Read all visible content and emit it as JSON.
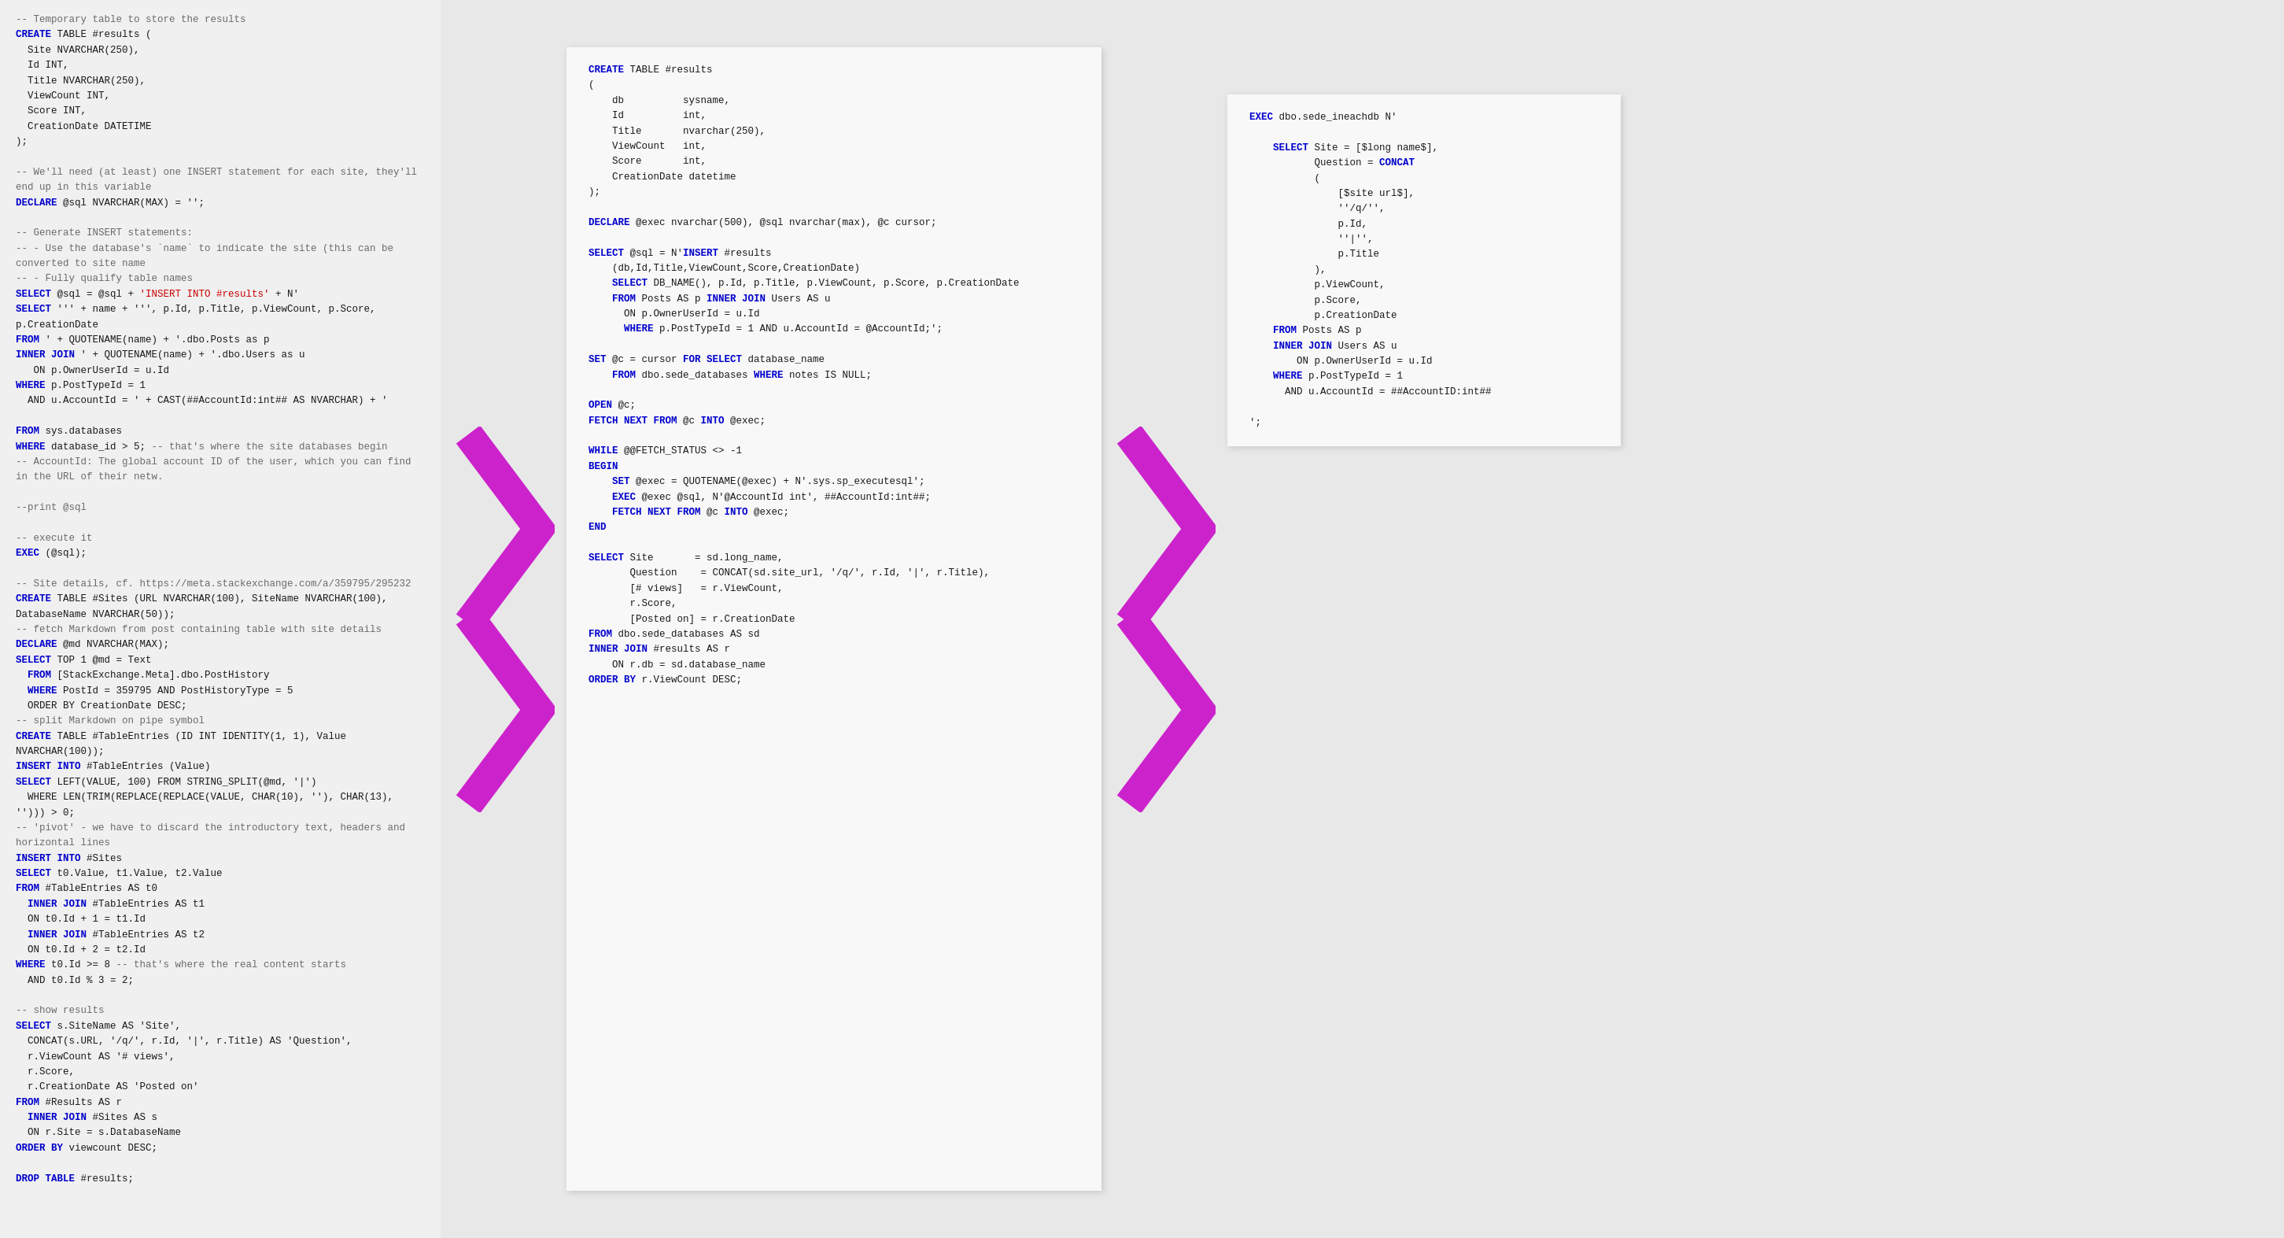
{
  "panels": {
    "left": {
      "lines": [
        {
          "text": "-- Temporary table to store the results",
          "type": "comment"
        },
        {
          "text": "CREATE TABLE #results (",
          "type": "keyword-start"
        },
        {
          "text": "  Site NVARCHAR(250),",
          "type": "code"
        },
        {
          "text": "  Id INT,",
          "type": "code"
        },
        {
          "text": "  Title NVARCHAR(250),",
          "type": "code"
        },
        {
          "text": "  ViewCount INT,",
          "type": "code"
        },
        {
          "text": "  Score INT,",
          "type": "code"
        },
        {
          "text": "  CreationDate DATETIME",
          "type": "code"
        },
        {
          "text": ");",
          "type": "code"
        },
        {
          "text": "",
          "type": "blank"
        },
        {
          "text": "-- We'll need (at least) one INSERT statement for each site, they'll end up in this variable",
          "type": "comment"
        },
        {
          "text": "DECLARE @sql NVARCHAR(MAX) = '';",
          "type": "code"
        },
        {
          "text": "",
          "type": "blank"
        },
        {
          "text": "-- Generate INSERT statements:",
          "type": "comment"
        },
        {
          "text": "-- - Use the database's `name` to indicate the site (this can be converted to site name",
          "type": "comment"
        },
        {
          "text": "-- - Fully qualify table names",
          "type": "comment"
        },
        {
          "text": "SELECT @sql = @sql + 'INSERT INTO #results' + N'",
          "type": "code"
        },
        {
          "text": "SELECT ''' + name + ''', p.Id, p.Title, p.ViewCount, p.Score, p.CreationDate",
          "type": "code"
        },
        {
          "text": "FROM ' + QUOTENAME(name) + '.dbo.Posts as p",
          "type": "code"
        },
        {
          "text": "INNER JOIN ' + QUOTENAME(name) + '.dbo.Users as u",
          "type": "code"
        },
        {
          "text": "  ON p.OwnerUserId = u.Id",
          "type": "code"
        },
        {
          "text": "WHERE p.PostTypeId = 1",
          "type": "code"
        },
        {
          "text": "  AND u.AccountId = ' + CAST(##AccountId:int## AS NVARCHAR) + '",
          "type": "code"
        },
        {
          "text": "",
          "type": "blank"
        },
        {
          "text": "FROM sys.databases",
          "type": "code"
        },
        {
          "text": "WHERE database_id > 5; -- that's where the site databases begin",
          "type": "code"
        },
        {
          "text": "-- AccountId: The global account ID of the user, which you can find in the URL of their netw.",
          "type": "comment"
        },
        {
          "text": "",
          "type": "blank"
        },
        {
          "text": "--print @sql",
          "type": "comment"
        },
        {
          "text": "",
          "type": "blank"
        },
        {
          "text": "-- execute it",
          "type": "comment"
        },
        {
          "text": "EXEC (@sql);",
          "type": "code"
        },
        {
          "text": "",
          "type": "blank"
        },
        {
          "text": "-- Site details, cf. https://meta.stackexchange.com/a/359795/295232",
          "type": "comment"
        },
        {
          "text": "CREATE TABLE #Sites (URL NVARCHAR(100), SiteName NVARCHAR(100), DatabaseName NVARCHAR(50));",
          "type": "code"
        },
        {
          "text": "-- fetch Markdown from post containing table with site details",
          "type": "comment"
        },
        {
          "text": "DECLARE @md NVARCHAR(MAX);",
          "type": "code"
        },
        {
          "text": "SELECT TOP 1 @md = Text",
          "type": "code"
        },
        {
          "text": "  FROM [StackExchange.Meta].dbo.PostHistory",
          "type": "code"
        },
        {
          "text": "  WHERE PostId = 359795 AND PostHistoryType = 5",
          "type": "code"
        },
        {
          "text": "  ORDER BY CreationDate DESC;",
          "type": "code"
        },
        {
          "text": "-- split Markdown on pipe symbol",
          "type": "comment"
        },
        {
          "text": "CREATE TABLE #TableEntries (ID INT IDENTITY(1, 1), Value NVARCHAR(100));",
          "type": "code"
        },
        {
          "text": "INSERT INTO #TableEntries (Value)",
          "type": "code"
        },
        {
          "text": "SELECT LEFT(VALUE, 100) FROM STRING_SPLIT(@md, '|')",
          "type": "code"
        },
        {
          "text": "  WHERE LEN(TRIM(REPLACE(REPLACE(VALUE, CHAR(10), ''), CHAR(13), ''))) > 0;",
          "type": "code"
        },
        {
          "text": "-- 'pivot' - we have to discard the introductory text, headers and horizontal lines",
          "type": "comment"
        },
        {
          "text": "INSERT INTO #Sites",
          "type": "code"
        },
        {
          "text": "SELECT t0.Value, t1.Value, t2.Value",
          "type": "code"
        },
        {
          "text": "FROM #TableEntries AS t0",
          "type": "code"
        },
        {
          "text": "  INNER JOIN #TableEntries AS t1",
          "type": "code"
        },
        {
          "text": "  ON t0.Id + 1 = t1.Id",
          "type": "code"
        },
        {
          "text": "  INNER JOIN #TableEntries AS t2",
          "type": "code"
        },
        {
          "text": "  ON t0.Id + 2 = t2.Id",
          "type": "code"
        },
        {
          "text": "WHERE t0.Id >= 8 -- that's where the real content starts",
          "type": "code"
        },
        {
          "text": "  AND t0.Id % 3 = 2;",
          "type": "code"
        },
        {
          "text": "",
          "type": "blank"
        },
        {
          "text": "-- show results",
          "type": "comment"
        },
        {
          "text": "SELECT s.SiteName AS 'Site',",
          "type": "code"
        },
        {
          "text": "  CONCAT(s.URL, '/q/', r.Id, '|', r.Title) AS 'Question',",
          "type": "code"
        },
        {
          "text": "  r.ViewCount AS '# views',",
          "type": "code"
        },
        {
          "text": "  r.Score,",
          "type": "code"
        },
        {
          "text": "  r.CreationDate AS 'Posted on'",
          "type": "code"
        },
        {
          "text": "FROM #Results AS r",
          "type": "code"
        },
        {
          "text": "  INNER JOIN #Sites AS s",
          "type": "code"
        },
        {
          "text": "  ON r.Site = s.DatabaseName",
          "type": "code"
        },
        {
          "text": "ORDER BY viewcount DESC;",
          "type": "code"
        },
        {
          "text": "",
          "type": "blank"
        },
        {
          "text": "DROP TABLE #results;",
          "type": "code"
        }
      ]
    },
    "middle": {
      "lines": [
        {
          "text": "CREATE TABLE #results",
          "type": "keyword-start"
        },
        {
          "text": "(",
          "type": "code"
        },
        {
          "text": "    db          sysname,",
          "type": "code"
        },
        {
          "text": "    Id          int,",
          "type": "code"
        },
        {
          "text": "    Title       nvarchar(250),",
          "type": "code"
        },
        {
          "text": "    ViewCount   int,",
          "type": "code"
        },
        {
          "text": "    Score       int,",
          "type": "code"
        },
        {
          "text": "    CreationDate datetime",
          "type": "code"
        },
        {
          "text": ");",
          "type": "code"
        },
        {
          "text": "",
          "type": "blank"
        },
        {
          "text": "DECLARE @exec nvarchar(500), @sql nvarchar(max), @c cursor;",
          "type": "code"
        },
        {
          "text": "",
          "type": "blank"
        },
        {
          "text": "SELECT @sql = N'INSERT #results",
          "type": "code"
        },
        {
          "text": "    (db,Id,Title,ViewCount,Score,CreationDate)",
          "type": "code"
        },
        {
          "text": "    SELECT DB_NAME(), p.Id, p.Title, p.ViewCount, p.Score, p.CreationDate",
          "type": "code"
        },
        {
          "text": "    FROM Posts AS p INNER JOIN Users AS u",
          "type": "code"
        },
        {
          "text": "      ON p.OwnerUserId = u.Id",
          "type": "code"
        },
        {
          "text": "      WHERE p.PostTypeId = 1 AND u.AccountId = @AccountId;';",
          "type": "code"
        },
        {
          "text": "",
          "type": "blank"
        },
        {
          "text": "SET @c = cursor FOR SELECT database_name",
          "type": "code"
        },
        {
          "text": "    FROM dbo.sede_databases WHERE notes IS NULL;",
          "type": "code"
        },
        {
          "text": "",
          "type": "blank"
        },
        {
          "text": "OPEN @c;",
          "type": "code"
        },
        {
          "text": "FETCH NEXT FROM @c INTO @exec;",
          "type": "code"
        },
        {
          "text": "",
          "type": "blank"
        },
        {
          "text": "WHILE @@FETCH_STATUS <> -1",
          "type": "code"
        },
        {
          "text": "BEGIN",
          "type": "code"
        },
        {
          "text": "    SET @exec = QUOTENAME(@exec) + N'.sys.sp_executesql';",
          "type": "code"
        },
        {
          "text": "    EXEC @exec @sql, N'@AccountId int', ##AccountId:int##;",
          "type": "code"
        },
        {
          "text": "    FETCH NEXT FROM @c INTO @exec;",
          "type": "code"
        },
        {
          "text": "END",
          "type": "code"
        },
        {
          "text": "",
          "type": "blank"
        },
        {
          "text": "SELECT Site       = sd.long_name,",
          "type": "code"
        },
        {
          "text": "       Question    = CONCAT(sd.site_url, '/q/', r.Id, '|', r.Title),",
          "type": "code"
        },
        {
          "text": "       [# views]   = r.ViewCount,",
          "type": "code"
        },
        {
          "text": "       r.Score,",
          "type": "code"
        },
        {
          "text": "       [Posted on] = r.CreationDate",
          "type": "code"
        },
        {
          "text": "FROM dbo.sede_databases AS sd",
          "type": "code"
        },
        {
          "text": "INNER JOIN #results AS r",
          "type": "code"
        },
        {
          "text": "    ON r.db = sd.database_name",
          "type": "code"
        },
        {
          "text": "ORDER BY r.ViewCount DESC;",
          "type": "code"
        }
      ]
    },
    "right": {
      "lines": [
        {
          "text": "EXEC dbo.sede_ineachdb N'",
          "type": "code"
        },
        {
          "text": "",
          "type": "blank"
        },
        {
          "text": "    SELECT Site = [$long name$],",
          "type": "code"
        },
        {
          "text": "           Question = CONCAT",
          "type": "code"
        },
        {
          "text": "           (",
          "type": "code"
        },
        {
          "text": "               [$site url$],",
          "type": "code"
        },
        {
          "text": "               ''/q/'',",
          "type": "code"
        },
        {
          "text": "               p.Id,",
          "type": "code"
        },
        {
          "text": "               ''|'',",
          "type": "code"
        },
        {
          "text": "               p.Title",
          "type": "code"
        },
        {
          "text": "           ),",
          "type": "code"
        },
        {
          "text": "           p.ViewCount,",
          "type": "code"
        },
        {
          "text": "           p.Score,",
          "type": "code"
        },
        {
          "text": "           p.CreationDate",
          "type": "code"
        },
        {
          "text": "    FROM Posts AS p",
          "type": "code"
        },
        {
          "text": "    INNER JOIN Users AS u",
          "type": "code"
        },
        {
          "text": "        ON p.OwnerUserId = u.Id",
          "type": "code"
        },
        {
          "text": "    WHERE p.PostTypeId = 1",
          "type": "code"
        },
        {
          "text": "      AND u.AccountId = ##AccountID:int##",
          "type": "code"
        },
        {
          "text": "",
          "type": "blank"
        },
        {
          "text": "';",
          "type": "code"
        }
      ]
    }
  },
  "arrows": {
    "color": "#cc22cc",
    "count": 2
  }
}
